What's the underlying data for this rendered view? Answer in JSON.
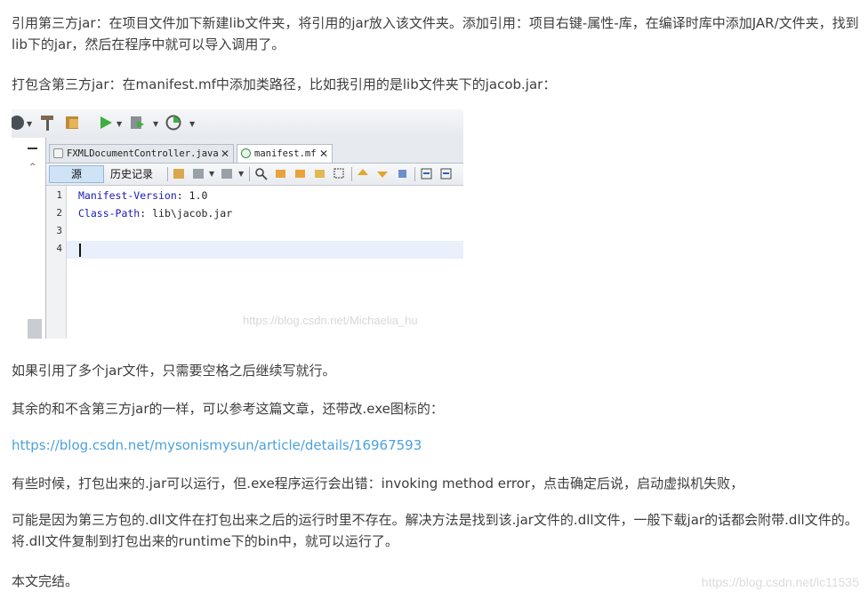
{
  "article": {
    "p1": "引用第三方jar：在项目文件加下新建lib文件夹，将引用的jar放入该文件夹。添加引用：项目右键-属性-库，在编译时库中添加JAR/文件夹，找到lib下的jar，然后在程序中就可以导入调用了。",
    "p2": "打包含第三方jar：在manifest.mf中添加类路径，比如我引用的是lib文件夹下的jacob.jar：",
    "p3": "如果引用了多个jar文件，只需要空格之后继续写就行。",
    "p4": "其余的和不含第三方jar的一样，可以参考这篇文章，还带改.exe图标的：",
    "link": "https://blog.csdn.net/mysonismysun/article/details/16967593",
    "p6": "有些时候，打包出来的.jar可以运行，但.exe程序运行会出错：invoking method error，点击确定后说，启动虚拟机失败，",
    "p7": "可能是因为第三方包的.dll文件在打包出来之后的运行时里不存在。解决方法是找到该.jar文件的.dll文件，一般下载jar的话都会附带.dll文件的。将.dll文件复制到打包出来的runtime下的bin中，就可以运行了。",
    "p8": "本文完结。"
  },
  "ide": {
    "tabs": [
      {
        "label": "FXMLDocumentController.java",
        "close": "✕"
      },
      {
        "label": "manifest.mf",
        "close": "✕"
      }
    ],
    "subtoolbar": {
      "source": "源",
      "history": "历史记录"
    },
    "line_numbers": [
      "1",
      "2",
      "3",
      "4"
    ],
    "code": [
      {
        "key": "Manifest-Version",
        "sep": ": ",
        "value": "1.0"
      },
      {
        "key": "Class-Path",
        "sep": ": ",
        "value": "lib\\jacob.jar"
      }
    ],
    "watermark": "https://blog.csdn.net/Michaelia_hu"
  },
  "page_watermark": "https://blog.csdn.net/lc11535",
  "colors": {
    "text": "#3d3d3d",
    "link": "#4ea1db",
    "keyword": "#1a1ab8"
  }
}
